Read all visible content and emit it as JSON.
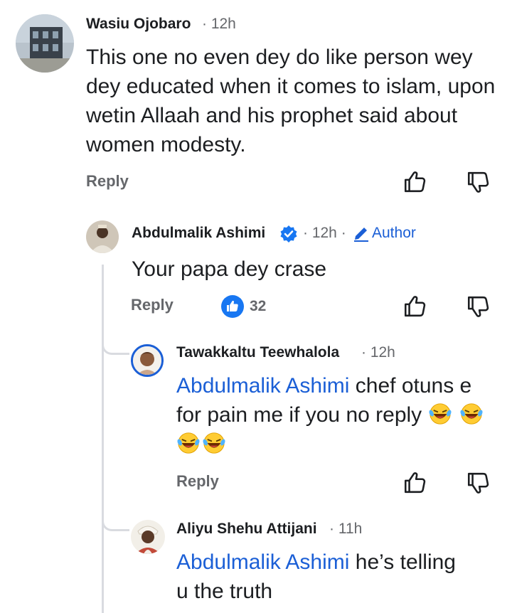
{
  "comments": [
    {
      "author": "Wasiu Ojobaro",
      "time": "12h",
      "text": "This one no even dey do like person wey dey educated when it comes to islam, upon wetin Allaah and his prophet said about women modesty.",
      "reply_label": "Reply"
    },
    {
      "author": "Abdulmalik Ashimi",
      "verified": true,
      "time": "12h",
      "badge": "Author",
      "text": "Your papa dey crase",
      "reply_label": "Reply",
      "reaction_count": "32"
    },
    {
      "author": "Tawakkaltu Teewhalola",
      "time": "12h",
      "mention": "Abdulmalik Ashimi",
      "text": "chef otuns e for pain me if you no reply",
      "emoji_count": 4,
      "reply_label": "Reply"
    },
    {
      "author": "Aliyu Shehu Attijani",
      "time": "11h",
      "mention": "Abdulmalik Ashimi",
      "text_line1": "he’s telling",
      "text_line2": "u the truth"
    }
  ],
  "colors": {
    "mention": "#1b5fd6",
    "reaction": "#1877f2",
    "secondary": "#65676b"
  },
  "icons": [
    "like-icon",
    "dislike-icon",
    "verified-badge-icon",
    "pencil-icon",
    "laughing-emoji-icon"
  ]
}
